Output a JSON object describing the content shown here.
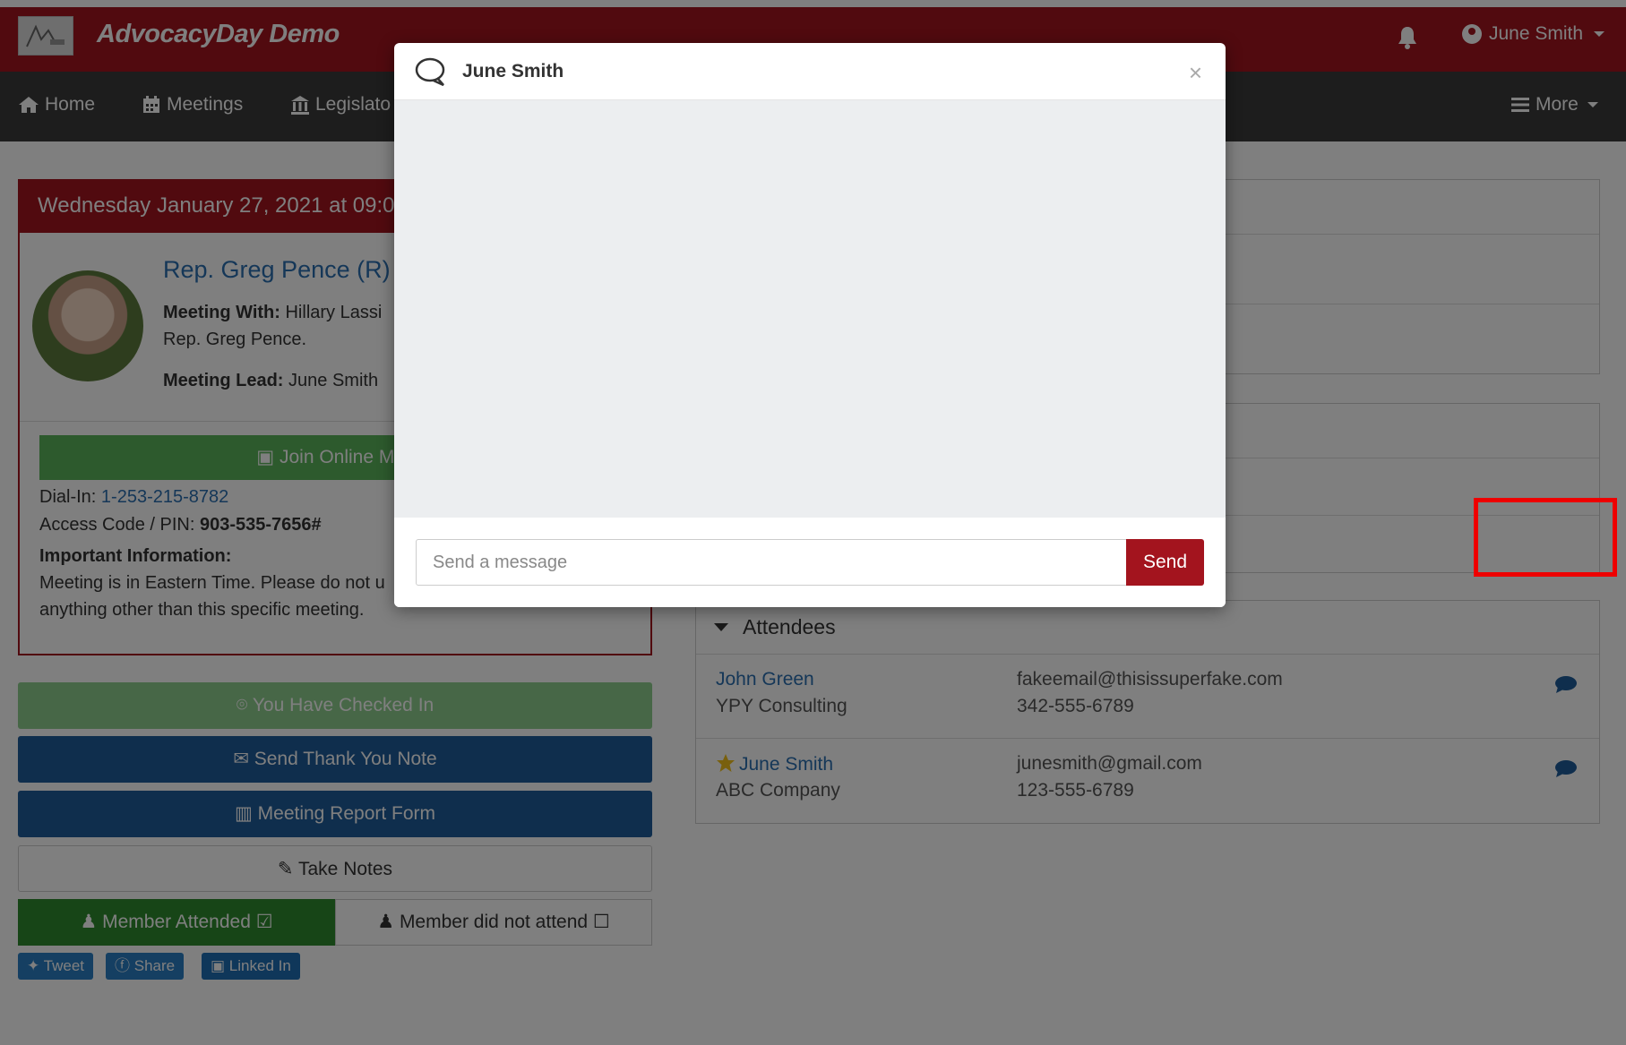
{
  "header": {
    "brand": "AdvocacyDay Demo",
    "user": "June Smith"
  },
  "nav": {
    "home": "Home",
    "meetings": "Meetings",
    "legislators": "Legislato",
    "more": "More"
  },
  "meeting": {
    "date": "Wednesday January 27, 2021 at 09:0",
    "rep_name": "Rep. Greg Pence (R) [I",
    "meeting_with_label": "Meeting With:",
    "meeting_with_value": "Hillary Lassi",
    "meeting_with_line2": "Rep. Greg Pence.",
    "lead_label": "Meeting Lead:",
    "lead_value": "June Smith",
    "join_label": "Join Online Mee",
    "dialin_label": "Dial-In:",
    "dialin_value": "1-253-215-8782",
    "access_label": "Access Code / PIN:",
    "access_value": "903-535-7656#",
    "important_label": "Important Information:",
    "important_line1": "Meeting is in Eastern Time. Please do not u",
    "important_line2": "anything other than this specific meeting."
  },
  "actions": {
    "checked_in": "You Have Checked In",
    "thank_you": "Send Thank You Note",
    "report": "Meeting Report Form",
    "notes": "Take Notes",
    "attended": "Member Attended",
    "not_attend": "Member did not attend"
  },
  "social": {
    "tweet": "Tweet",
    "share": "Share",
    "linkedin": "Linked In"
  },
  "attendees": {
    "title": "Attendees",
    "rows": [
      {
        "name": "John Green",
        "org": "YPY Consulting",
        "email": "fakeemail@thisissuperfake.com",
        "phone": "342-555-6789"
      },
      {
        "name": "June Smith",
        "org": "ABC Company",
        "email": "junesmith@gmail.com",
        "phone": "123-555-6789"
      }
    ]
  },
  "modal": {
    "title": "June Smith",
    "close": "×",
    "input_placeholder": "Send a message",
    "send": "Send"
  },
  "colors": {
    "brand_red": "#a3141e",
    "nav_dark": "#3b3b3b",
    "link_blue": "#2a6fb0",
    "button_blue": "#1f5c9a",
    "success_green": "#2e8b2e",
    "highlight_red": "#e00000"
  },
  "icons": {
    "bell": "bell-icon",
    "user": "user-circle-icon",
    "home": "home-icon",
    "meetings": "calendar-icon",
    "legislators": "capitol-icon",
    "more": "hamburger-icon",
    "chat": "chat-bubble-icon",
    "close": "close-icon",
    "star": "star-icon"
  }
}
